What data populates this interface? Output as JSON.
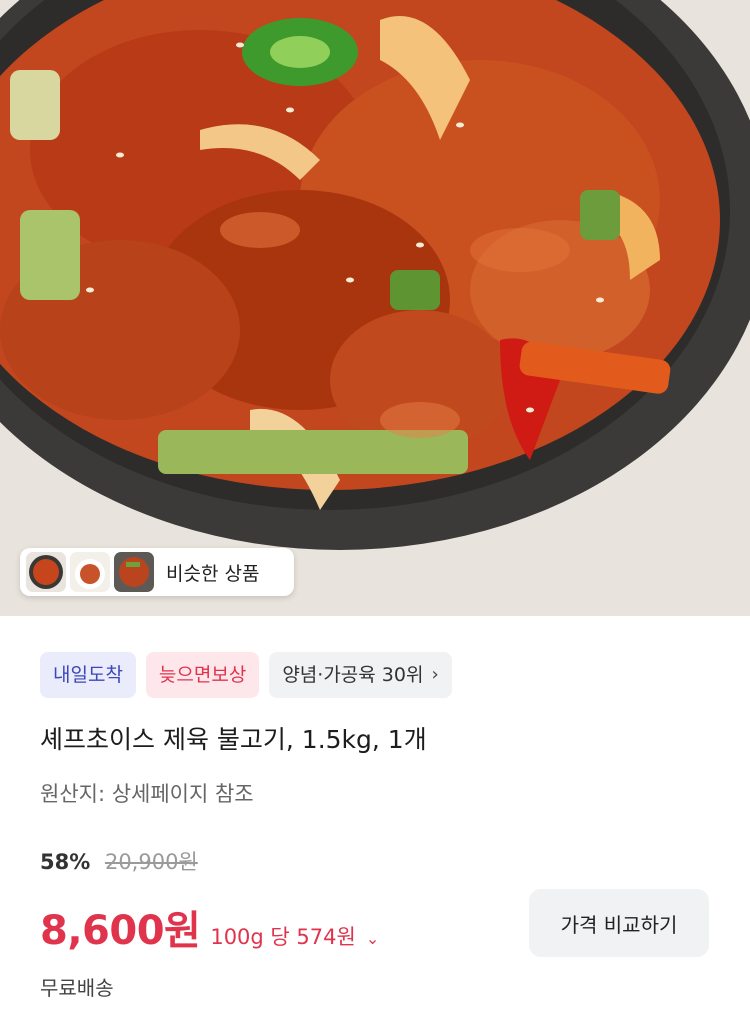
{
  "hero": {
    "similar_label": "비슷한 상품",
    "thumb_icons": [
      "food-thumb-1",
      "food-thumb-2",
      "food-thumb-3"
    ]
  },
  "badges": {
    "delivery": "내일도착",
    "guarantee": "늦으면보상",
    "ranking": "양념·가공육 30위"
  },
  "product": {
    "title": "셰프초이스 제육 불고기, 1.5kg, 1개",
    "origin": "원산지: 상세페이지 참조"
  },
  "pricing": {
    "discount_rate": "58%",
    "original_price": "20,900원",
    "sale_price": "8,600원",
    "unit_price": "100g 당 574원",
    "compare_label": "가격 비교하기"
  },
  "shipping": {
    "label": "무료배송"
  },
  "colors": {
    "accent_red": "#e0344d",
    "badge_blue": "#3c47b8",
    "badge_blue_bg": "#eaecfb",
    "badge_red_bg": "#fde7ea"
  }
}
